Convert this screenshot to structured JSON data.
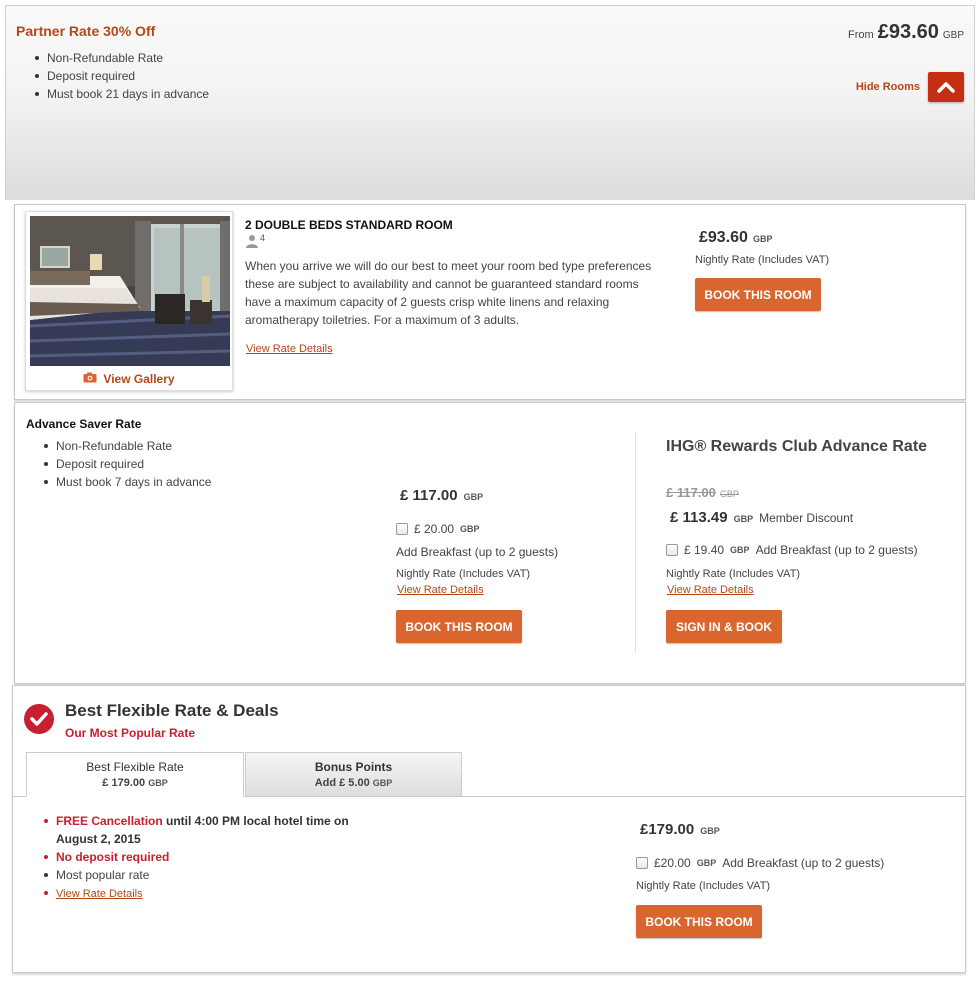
{
  "partner_rate": {
    "title": "Partner Rate 30% Off",
    "bullets": [
      "Non-Refundable Rate",
      "Deposit required",
      "Must book 21 days in advance"
    ],
    "from_label": "From",
    "price": "£93.60",
    "currency": "GBP",
    "hide_rooms_label": "Hide Rooms"
  },
  "room": {
    "title": "2 DOUBLE BEDS STANDARD ROOM",
    "max_guests": "4",
    "description": "When you arrive we will do our best to meet your room bed type preferences these are subject to availability and cannot be guaranteed standard rooms have a maximum capacity of 2 guests crisp white linens and relaxing aromatherapy toiletries. For a maximum of 3 adults.",
    "view_rate_details": "View Rate Details",
    "view_gallery": "View Gallery",
    "price": "£93.60",
    "currency": "GBP",
    "nightly_note": "Nightly Rate (Includes VAT)",
    "book_label": "BOOK THIS ROOM"
  },
  "advance_saver": {
    "title": "Advance Saver Rate",
    "bullets": [
      "Non-Refundable Rate",
      "Deposit required",
      "Must book 7 days in advance"
    ],
    "price": "£ 117.00",
    "currency": "GBP",
    "breakfast_price": "£ 20.00",
    "breakfast_currency": "GBP",
    "breakfast_label": "Add Breakfast (up to 2 guests)",
    "nightly_note": "Nightly Rate (Includes VAT)",
    "view_rate_details": "View Rate Details",
    "book_label": "BOOK THIS ROOM"
  },
  "ihg": {
    "title": "IHG® Rewards Club Advance Rate",
    "old_price": "£ 117.00",
    "old_currency": "GBP",
    "price": "£ 113.49",
    "currency": "GBP",
    "discount_label": "Member Discount",
    "breakfast_price": "£ 19.40",
    "breakfast_currency": "GBP",
    "breakfast_label": "Add Breakfast (up to 2 guests)",
    "nightly_note": "Nightly Rate (Includes VAT)",
    "view_rate_details": "View Rate Details",
    "signin_label": "SIGN IN & BOOK"
  },
  "best_flexible": {
    "title": "Best Flexible Rate & Deals",
    "subtitle": "Our Most Popular Rate",
    "tabs": [
      {
        "label": "Best Flexible Rate",
        "price": "£ 179.00",
        "currency": "GBP"
      },
      {
        "label": "Bonus Points",
        "price": "Add £ 5.00",
        "currency": "GBP"
      }
    ],
    "free_cancel": "FREE Cancellation",
    "cancel_rest": " until 4:00 PM local hotel time on",
    "cancel_date": "August 2, 2015",
    "no_deposit": "No deposit required",
    "most_popular": "Most popular rate",
    "view_rate_details": "View Rate Details",
    "price": "£179.00",
    "currency": "GBP",
    "breakfast_price": "£20.00",
    "breakfast_currency": "GBP",
    "breakfast_label": "Add Breakfast (up to 2 guests)",
    "nightly_note": "Nightly Rate (Includes VAT)",
    "book_label": "BOOK THIS ROOM"
  },
  "colors": {
    "accent": "#d9662f",
    "link": "#b5471b",
    "red": "#c8202f"
  }
}
